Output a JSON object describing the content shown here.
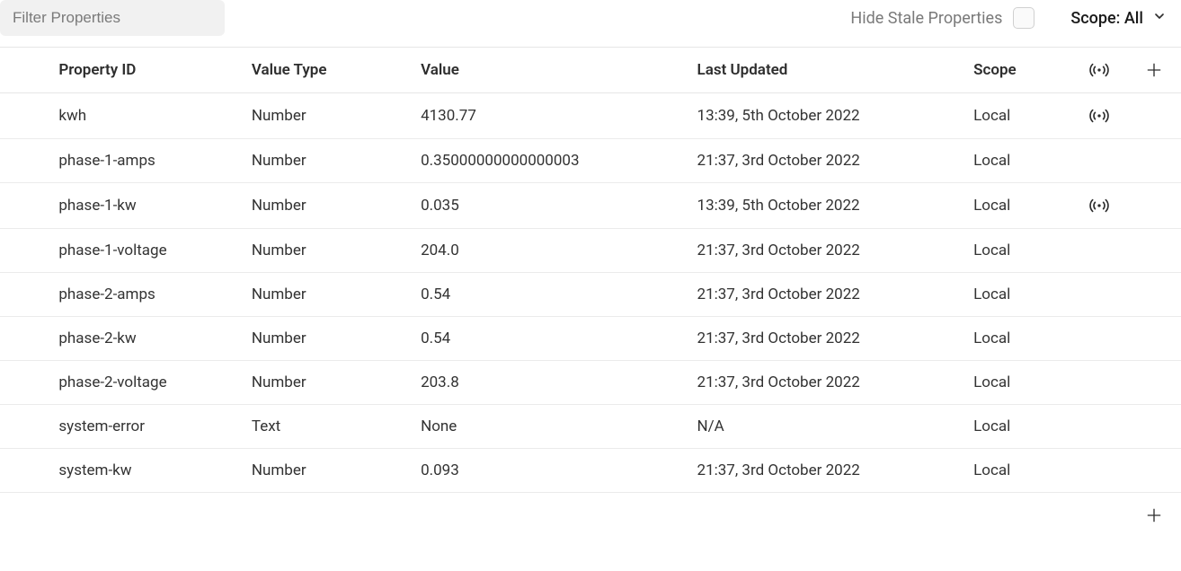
{
  "toolbar": {
    "filter_placeholder": "Filter Properties",
    "hide_stale_label": "Hide Stale Properties",
    "scope_label": "Scope: All"
  },
  "table": {
    "headers": {
      "property_id": "Property ID",
      "value_type": "Value Type",
      "value": "Value",
      "last_updated": "Last Updated",
      "scope": "Scope"
    },
    "rows": [
      {
        "property_id": "kwh",
        "value_type": "Number",
        "value": "4130.77",
        "last_updated": "13:39, 5th October 2022",
        "scope": "Local",
        "live": true
      },
      {
        "property_id": "phase-1-amps",
        "value_type": "Number",
        "value": "0.35000000000000003",
        "last_updated": "21:37, 3rd October 2022",
        "scope": "Local",
        "live": false
      },
      {
        "property_id": "phase-1-kw",
        "value_type": "Number",
        "value": "0.035",
        "last_updated": "13:39, 5th October 2022",
        "scope": "Local",
        "live": true
      },
      {
        "property_id": "phase-1-voltage",
        "value_type": "Number",
        "value": "204.0",
        "last_updated": "21:37, 3rd October 2022",
        "scope": "Local",
        "live": false
      },
      {
        "property_id": "phase-2-amps",
        "value_type": "Number",
        "value": "0.54",
        "last_updated": "21:37, 3rd October 2022",
        "scope": "Local",
        "live": false
      },
      {
        "property_id": "phase-2-kw",
        "value_type": "Number",
        "value": "0.54",
        "last_updated": "21:37, 3rd October 2022",
        "scope": "Local",
        "live": false
      },
      {
        "property_id": "phase-2-voltage",
        "value_type": "Number",
        "value": "203.8",
        "last_updated": "21:37, 3rd October 2022",
        "scope": "Local",
        "live": false
      },
      {
        "property_id": "system-error",
        "value_type": "Text",
        "value": "None",
        "last_updated": "N/A",
        "scope": "Local",
        "live": false
      },
      {
        "property_id": "system-kw",
        "value_type": "Number",
        "value": "0.093",
        "last_updated": "21:37, 3rd October 2022",
        "scope": "Local",
        "live": false
      }
    ]
  }
}
